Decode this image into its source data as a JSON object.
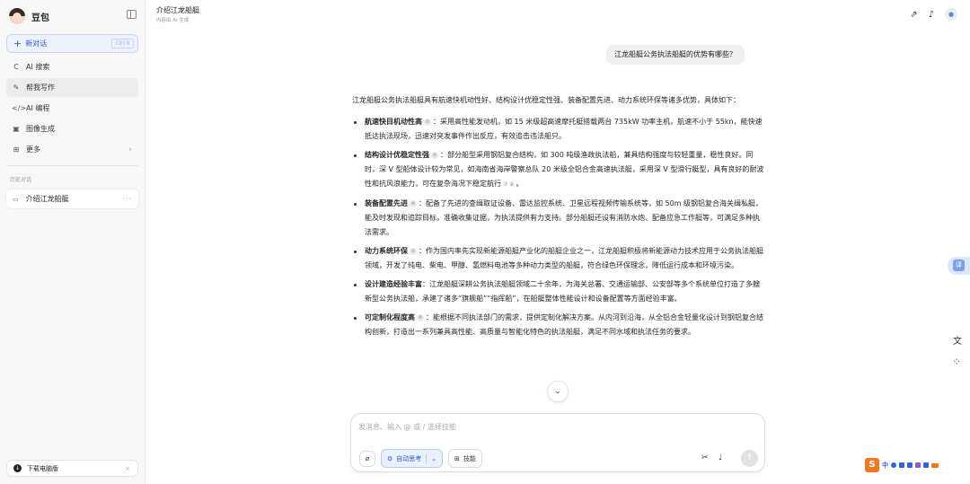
{
  "sidebar": {
    "brand": "豆包",
    "new_chat": "新对话",
    "new_chat_shortcut": "Ctrl K",
    "items": [
      {
        "icon": "C",
        "label": "AI 搜索"
      },
      {
        "icon": "✎",
        "label": "帮我写作"
      },
      {
        "icon": "</>",
        "label": "AI 编程"
      },
      {
        "icon": "▣",
        "label": "图像生成"
      },
      {
        "icon": "⊞",
        "label": "更多"
      }
    ],
    "history_label": "历史对话",
    "history_items": [
      {
        "label": "介绍江龙船艇"
      }
    ],
    "download_label": "下载电脑版"
  },
  "header": {
    "title": "介绍江龙船艇",
    "subtitle": "内容由 AI 生成"
  },
  "question": "江龙船艇公务执法船艇的优势有哪些？",
  "answer": {
    "intro": "江龙船艇公务执法船艇具有航速快机动性好、结构设计优稳定性强、装备配置先进、动力系统环保等诸多优势，具体如下：",
    "items": [
      {
        "title": "航速快目机动性高",
        "cite": "①",
        "text": "：采用高性能发动机，如 15 米级超高速摩托艇搭载两台 735kW 功率主机，航速不小于 55kn，能快速抵达执法现场，迅速对突发事件作出反应，有效追击违法船只。"
      },
      {
        "title": "结构设计优稳定性强",
        "cite": "②",
        "text": "：部分船型采用钢铝复合结构，如 300 吨级渔政执法船，兼具结构强度与较轻重量，稳性良好。同时，深 V 型船体设计较为常见，如海南省海岸警察总队 20 米级全铝合金高速执法艇，采用深 V 型滑行艇型，具有良好的耐波性和抗风浪能力，可在复杂海况下稳定航行",
        "cites2": "⑦ ⑧",
        "tail": "。"
      },
      {
        "title": "装备配置先进",
        "cite": "④",
        "text": "：配备了先进的查缉取证设备、雷达监控系统、卫星远程视频传输系统等，如 50m 级钢铝复合海关缉私艇，能及时发现和追踪目标，准确收集证据，为执法提供有力支持。部分船艇还设有消防水炮、配备应急工作艇等，可满足多种执法需求。"
      },
      {
        "title": "动力系统环保",
        "cite": "③",
        "text": "：作为国内率先实现新能源船艇产业化的船艇企业之一，江龙船艇积极将新能源动力技术应用于公务执法船艇领域，开发了纯电、柴电、甲醇、氢燃料电池等多种动力类型的船艇，符合绿色环保理念，降低运行成本和环境污染。"
      },
      {
        "title": "设计建造经验丰富",
        "cite": "",
        "text": "：江龙船艇深耕公务执法船艇领域二十余年，为海关总署、交通运输部、公安部等多个系统单位打造了多艘新型公务执法船，承建了诸多“旗舰船”“指挥船”，在船艇整体性能设计和设备配置等方面经验丰富。"
      },
      {
        "title": "可定制化程度高",
        "cite": "⑥",
        "text": "：能根据不同执法部门的需求，提供定制化解决方案。从内河到沿海，从全铝合金轻量化设计到钢铝复合结构创新，打造出一系列兼具高性能、高质量与智能化特色的执法船艇，满足不同水域和执法任务的要求。"
      }
    ]
  },
  "composer": {
    "placeholder": "发消息、输入 @ 或 / 选择技能",
    "think_label": "自动思考",
    "skills_label": "技能"
  },
  "ime": {
    "label": "中"
  },
  "float_label": "译",
  "colors": {
    "accent": "#2b5bd7",
    "sidebar_bg": "#f7f7f8",
    "bubble_bg": "#f0f0f1"
  }
}
